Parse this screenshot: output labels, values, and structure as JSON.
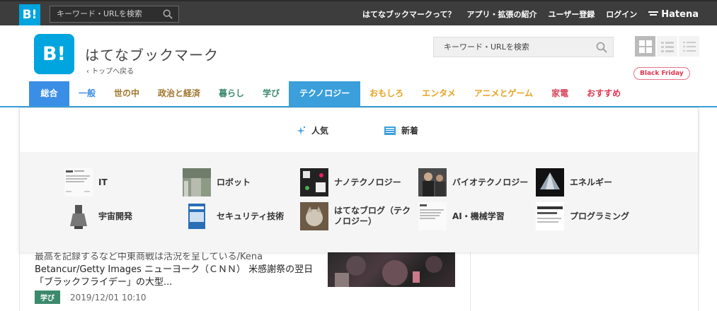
{
  "global_bar": {
    "logo": "B!",
    "search_placeholder": "キーワード・URLを検索",
    "nav": [
      "はてなブックマークって？",
      "アプリ・拡張の紹介",
      "ユーザー登録",
      "ログイン"
    ],
    "hatena": "Hatena"
  },
  "header": {
    "logo": "B!",
    "title": "はてなブックマーク",
    "back": "トップへ戻る",
    "search_placeholder": "キーワード・URLを検索"
  },
  "categories": [
    {
      "label": "総合",
      "color": "#ffffff"
    },
    {
      "label": "一般",
      "color": "#3a8ee6"
    },
    {
      "label": "世の中",
      "color": "#a0752a"
    },
    {
      "label": "政治と経済",
      "color": "#a0752a"
    },
    {
      "label": "暮らし",
      "color": "#3c8a6e"
    },
    {
      "label": "学び",
      "color": "#3c8a6e"
    },
    {
      "label": "テクノロジー",
      "color": "#ffffff"
    },
    {
      "label": "おもしろ",
      "color": "#e5a323"
    },
    {
      "label": "エンタメ",
      "color": "#e5a323"
    },
    {
      "label": "アニメとゲーム",
      "color": "#e5a323"
    },
    {
      "label": "家電",
      "color": "#d9475c"
    },
    {
      "label": "おすすめ",
      "color": "#e0364f"
    }
  ],
  "badge": "Black Friday",
  "dropdown": {
    "tabs": [
      "人気",
      "新着"
    ],
    "subcategories": [
      {
        "label": "IT"
      },
      {
        "label": "ロボット"
      },
      {
        "label": "ナノテクノロジー"
      },
      {
        "label": "バイオテクノロジー"
      },
      {
        "label": "エネルギー"
      },
      {
        "label": "宇宙開発"
      },
      {
        "label": "セキュリティ技術"
      },
      {
        "label": "はてなブログ（テクノロジー）"
      },
      {
        "label": "AI・機械学習"
      },
      {
        "label": "プログラミング"
      }
    ]
  },
  "article": {
    "line0": "最高を記録するなど中東商戦は活況を呈している/Kena",
    "line1": "Betancur/Getty Images ニューヨーク（ＣＮＮ） 米感謝祭の翌日",
    "line2": "「ブラックフライデー」の大型...",
    "tag": "学び",
    "date": "2019/12/01 10:10"
  },
  "colors": {
    "brand": "#00a4de",
    "tech": "#3a9fdb"
  }
}
